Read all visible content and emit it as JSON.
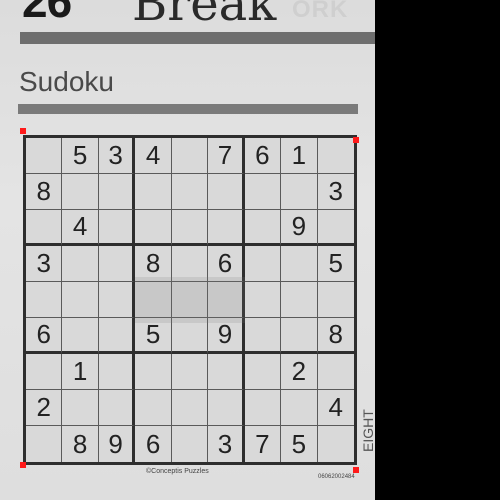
{
  "header": {
    "number": "26",
    "word": "Break",
    "ghost_text": "ORK"
  },
  "section_title": "Sudoku",
  "puzzle": {
    "rows": [
      [
        "",
        "5",
        "3",
        "4",
        "",
        "7",
        "6",
        "1",
        ""
      ],
      [
        "8",
        "",
        "",
        "",
        "",
        "",
        "",
        "",
        "3"
      ],
      [
        "",
        "4",
        "",
        "",
        "",
        "",
        "",
        "9",
        ""
      ],
      [
        "3",
        "",
        "",
        "8",
        "",
        "6",
        "",
        "",
        "5"
      ],
      [
        "",
        "",
        "",
        "",
        "",
        "",
        "",
        "",
        ""
      ],
      [
        "6",
        "",
        "",
        "5",
        "",
        "9",
        "",
        "",
        "8"
      ],
      [
        "",
        "1",
        "",
        "",
        "",
        "",
        "",
        "2",
        ""
      ],
      [
        "2",
        "",
        "",
        "",
        "",
        "",
        "",
        "",
        "4"
      ],
      [
        "",
        "8",
        "9",
        "6",
        "",
        "3",
        "7",
        "5",
        ""
      ]
    ]
  },
  "footer": {
    "credit": "©Conceptis Puzzles",
    "code": "06062002484",
    "side_text": "EIGHT"
  },
  "colors": {
    "paper": "#dcdcdc",
    "ink": "#222222",
    "marker": "#ff1a1a",
    "background": "#000000"
  }
}
